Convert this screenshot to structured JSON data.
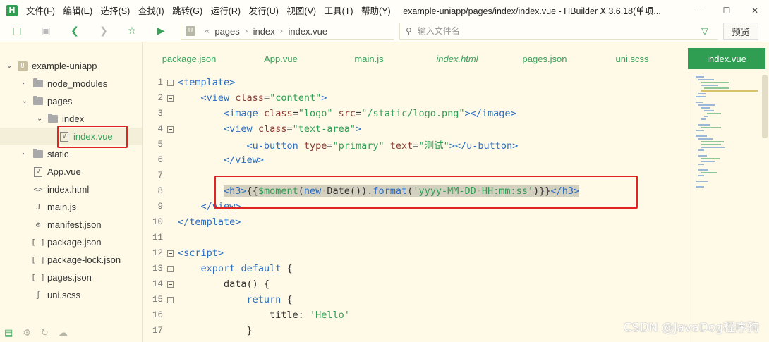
{
  "app": {
    "logo": "H",
    "menus": [
      "文件(F)",
      "编辑(E)",
      "选择(S)",
      "查找(I)",
      "跳转(G)",
      "运行(R)",
      "发行(U)",
      "视图(V)",
      "工具(T)",
      "帮助(Y)"
    ],
    "window_title": "example-uniapp/pages/index/index.vue - HBuilder X 3.6.18(单项..."
  },
  "toolbar": {
    "breadcrumb": [
      "pages",
      "index",
      "index.vue"
    ],
    "search_placeholder": "输入文件名",
    "preview_label": "预览",
    "icons": [
      "new-file-icon",
      "save-icon",
      "back-icon",
      "forward-icon",
      "star-icon",
      "run-icon"
    ]
  },
  "sidebar": {
    "items": [
      {
        "label": "example-uniapp",
        "icon": "project-icon",
        "expanded": true
      },
      {
        "label": "node_modules",
        "icon": "folder-icon",
        "expanded": false
      },
      {
        "label": "pages",
        "icon": "folder-icon",
        "expanded": true
      },
      {
        "label": "index",
        "icon": "folder-icon",
        "expanded": true
      },
      {
        "label": "index.vue",
        "icon": "vue-file-icon",
        "selected": true
      },
      {
        "label": "static",
        "icon": "folder-icon",
        "expanded": false
      },
      {
        "label": "App.vue",
        "icon": "vue-file-icon"
      },
      {
        "label": "index.html",
        "icon": "html-file-icon"
      },
      {
        "label": "main.js",
        "icon": "js-file-icon"
      },
      {
        "label": "manifest.json",
        "icon": "manifest-icon"
      },
      {
        "label": "package.json",
        "icon": "json-file-icon"
      },
      {
        "label": "package-lock.json",
        "icon": "json-file-icon"
      },
      {
        "label": "pages.json",
        "icon": "json-file-icon"
      },
      {
        "label": "uni.scss",
        "icon": "scss-file-icon"
      }
    ]
  },
  "tabs": [
    {
      "label": "package.json"
    },
    {
      "label": "App.vue"
    },
    {
      "label": "main.js"
    },
    {
      "label": "index.html",
      "italic": true
    },
    {
      "label": "pages.json"
    },
    {
      "label": "uni.scss"
    },
    {
      "label": "index.vue",
      "active": true
    }
  ],
  "editor": {
    "line_numbers": [
      "1",
      "2",
      "3",
      "4",
      "5",
      "6",
      "7",
      "8",
      "9",
      "10",
      "11",
      "12",
      "13",
      "14",
      "15",
      "16",
      "17"
    ],
    "tokens": {
      "template_open": "<template>",
      "view_open": "<view",
      "class_attr": "class",
      "eq": "=",
      "content_val": "\"content\"",
      "gt": ">",
      "image_open": "<image",
      "logo_val": "\"logo\"",
      "src_attr": "src",
      "src_val": "\"/static/logo.png\"",
      "image_close": "></image>",
      "text_area_val": "\"text-area\"",
      "ubutton_open": "<u-button",
      "type_attr": "type",
      "type_val": "\"primary\"",
      "text_attr": "text",
      "text_val": "\"测试\"",
      "ubutton_close": "></u-button>",
      "view_close": "</view>",
      "h3_open": "<h3>",
      "mustache_open": "{{",
      "moment_fn": "$moment",
      "paren_open": "(",
      "new_kw": "new",
      "date_fn": "Date",
      "call_end": "()).",
      "format_fn": "format",
      "format_arg": "'yyyy-MM-DD",
      "format_arg_end": "HH:mm:ss'",
      "mustache_close": ")}}",
      "h3_close": "</h3>",
      "view_close_2": "</view>",
      "template_close": "</template>",
      "script_open": "<script>",
      "export_kw": "export",
      "default_kw": "default",
      "brace_open": "{",
      "data_fn": "data() {",
      "return_kw": "return",
      "title_key": "title:",
      "hello_val": "'Hello'",
      "brace_close": "}"
    }
  },
  "watermark": "CSDN @JavaDog程序狗"
}
